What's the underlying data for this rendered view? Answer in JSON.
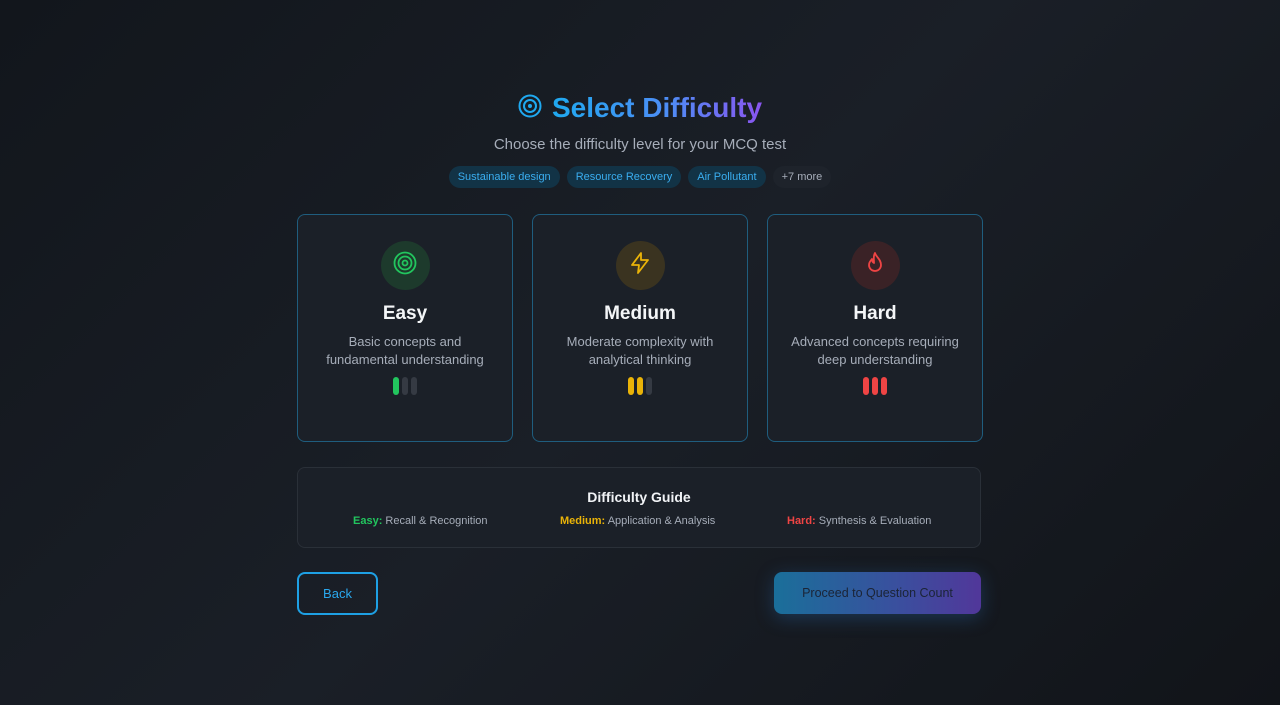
{
  "header": {
    "title": "Select Difficulty",
    "subtitle": "Choose the difficulty level for your MCQ test",
    "title_icon": "target-icon"
  },
  "tags": [
    {
      "label": "Sustainable design"
    },
    {
      "label": "Resource Recovery"
    },
    {
      "label": "Air Pollutant"
    },
    {
      "label": "+7 more"
    }
  ],
  "levels": [
    {
      "name": "Easy",
      "description": "Basic concepts and fundamental understanding",
      "icon": "target-icon",
      "color": "#22c55e",
      "icon_bg": "#1d3a2c",
      "filled_bars": 1,
      "total_bars": 3
    },
    {
      "name": "Medium",
      "description": "Moderate complexity with analytical thinking",
      "icon": "lightning-icon",
      "color": "#eab308",
      "icon_bg": "#3a3320",
      "filled_bars": 2,
      "total_bars": 3
    },
    {
      "name": "Hard",
      "description": "Advanced concepts requiring deep understanding",
      "icon": "flame-icon",
      "color": "#ef4444",
      "icon_bg": "#3a2226",
      "filled_bars": 3,
      "total_bars": 3
    }
  ],
  "guide": {
    "title": "Difficulty Guide",
    "items": [
      {
        "level": "Easy:",
        "text": "Recall & Recognition",
        "color": "#22c55e"
      },
      {
        "level": "Medium:",
        "text": "Application & Analysis",
        "color": "#eab308"
      },
      {
        "level": "Hard:",
        "text": "Synthesis & Evaluation",
        "color": "#ef4444"
      }
    ]
  },
  "actions": {
    "back_label": "Back",
    "proceed_label": "Proceed to Question Count"
  }
}
